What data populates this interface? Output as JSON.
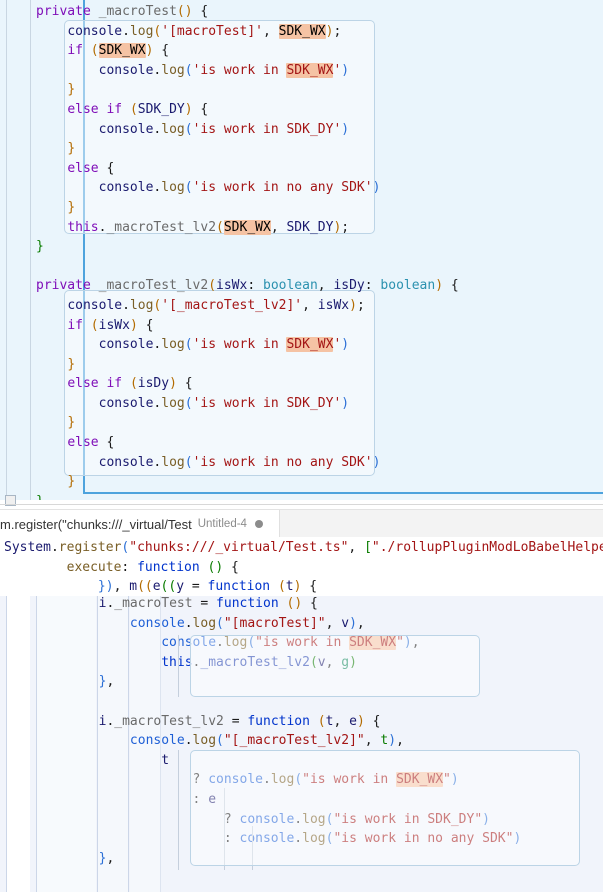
{
  "app": {
    "kind": "code-editor",
    "colors": {
      "top_panel_bg": "#eaf5fc",
      "bottom_panel_bg": "#f1f4fb",
      "selection_border": "#4ea3dd",
      "search_highlight": "#f5c3a4",
      "block_border": "#bcd4e6",
      "keyword": "#7f0eb8",
      "string": "#a31515",
      "function_keyword": "#0033cc"
    }
  },
  "tabbar": {
    "active_tab": {
      "path_label": "m.register(\"chunks:///_virtual/Test",
      "sub_label": "Untitled-4",
      "dirty_indicator": "●"
    }
  },
  "top_editor": {
    "lines": [
      "private _macroTest() {",
      "    console.log('[macroTest]', SDK_WX);",
      "    if (SDK_WX) {",
      "        console.log('is work in SDK_WX')",
      "    }",
      "    else if (SDK_DY) {",
      "        console.log('is work in SDK_DY')",
      "    }",
      "    else {",
      "        console.log('is work in no any SDK')",
      "    }",
      "    this._macroTest_lv2(SDK_WX, SDK_DY);",
      "}",
      "",
      "private _macroTest_lv2(isWx: boolean, isDy: boolean) {",
      "    console.log('[_macroTest_lv2]', isWx);",
      "    if (isWx) {",
      "        console.log('is work in SDK_WX')",
      "    }",
      "    else if (isDy) {",
      "        console.log('is work in SDK_DY')",
      "    }",
      "    else {",
      "        console.log('is work in no any SDK')",
      "    }",
      "}"
    ],
    "highlighted_term": "SDK_WX"
  },
  "header_code": {
    "lines": [
      "System.register(\"chunks:///_virtual/Test.ts\", [\"./rollupPluginModLoBabelHelper",
      "        execute: function () {",
      "            }), m((e((y = function (t) {"
    ]
  },
  "bottom_output": {
    "lines": [
      "        i._macroTest = function () {",
      "            console.log(\"[macroTest]\", v),",
      "                console.log(\"is work in SDK_WX\"),",
      "                this._macroTest_lv2(v, g)",
      "        },",
      "",
      "        i._macroTest_lv2 = function (t, e) {",
      "            console.log(\"[_macroTest_lv2]\", t),",
      "                t",
      "                    ? console.log(\"is work in SDK_WX\")",
      "                    : e",
      "                        ? console.log(\"is work in SDK_DY\")",
      "                        : console.log(\"is work in no any SDK\")",
      "        },"
    ],
    "highlighted_term": "SDK_WX"
  }
}
